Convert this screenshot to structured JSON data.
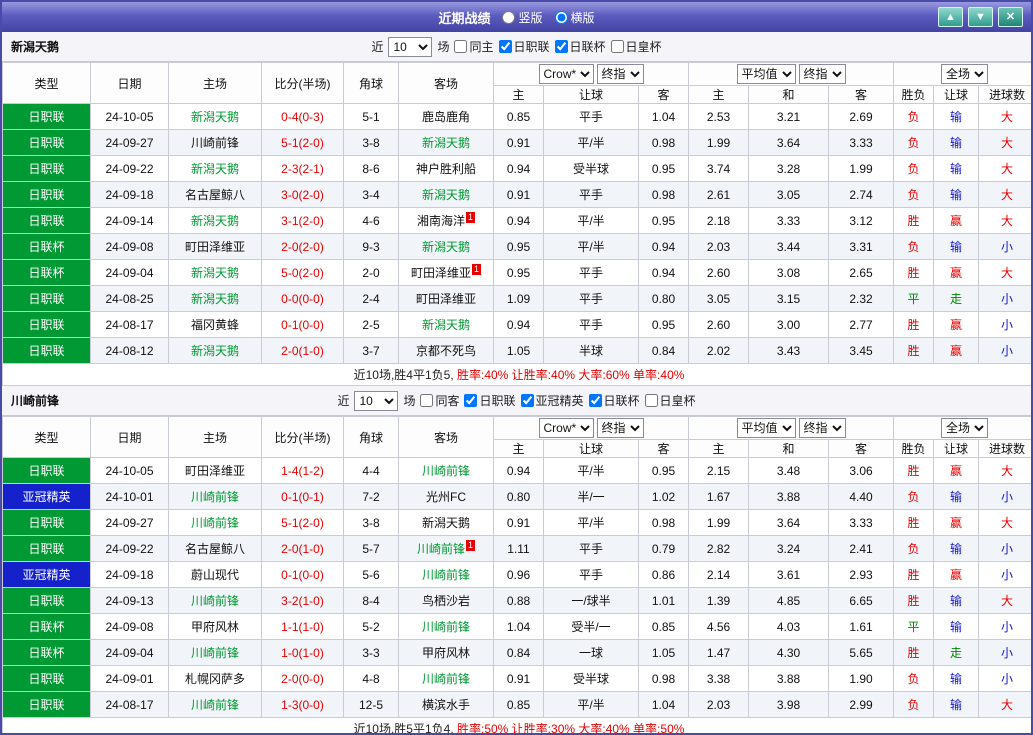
{
  "titlebar": {
    "title": "近期战绩",
    "layout_options": [
      {
        "label": "竖版",
        "selected": false
      },
      {
        "label": "横版",
        "selected": true
      }
    ],
    "up_icon": "▲",
    "down_icon": "▼",
    "close_icon": "✕"
  },
  "table_header": {
    "type": "类型",
    "date": "日期",
    "home": "主场",
    "score": "比分(半场)",
    "corner": "角球",
    "away": "客场",
    "bookmaker": "Crow*",
    "final_odds": "终指",
    "average": "平均值",
    "full_match": "全场",
    "asia_home": "主",
    "asia_handicap": "让球",
    "asia_away": "客",
    "euro_home": "主",
    "euro_draw": "和",
    "euro_away": "客",
    "result_wdl": "胜负",
    "result_handicap": "让球",
    "result_goals": "进球数"
  },
  "colors": {
    "league": {
      "日职联": "#009933",
      "日联杯": "#009933",
      "日皇杯": "#009933",
      "亚冠精英": "#1522cc"
    },
    "result": {
      "胜": "#e60000",
      "负": "#e60000",
      "平": "#008800",
      "赢": "#e60000",
      "输": "#1515cc",
      "走": "#008800",
      "大": "#e60000",
      "小": "#1515cc"
    },
    "team_highlight": "#009933",
    "score": "#e60000"
  },
  "sections": [
    {
      "team": "新潟天鹅",
      "controls": {
        "near": "近",
        "count": "10",
        "games": "场",
        "same_label": "同主",
        "same_checked": false,
        "competitions": [
          {
            "label": "日职联",
            "checked": true
          },
          {
            "label": "日联杯",
            "checked": true
          },
          {
            "label": "日皇杯",
            "checked": false
          }
        ]
      },
      "rows": [
        {
          "type": "日职联",
          "date": "24-10-05",
          "home": "新潟天鹅",
          "home_hl": true,
          "home_card": 0,
          "score": "0-4(0-3)",
          "corner": "5-1",
          "away": "鹿岛鹿角",
          "away_hl": false,
          "away_card": 0,
          "odds": [
            "0.85",
            "平手",
            "1.04",
            "2.53",
            "3.21",
            "2.69"
          ],
          "results": [
            "负",
            "输",
            "大"
          ]
        },
        {
          "type": "日职联",
          "date": "24-09-27",
          "home": "川崎前锋",
          "home_hl": false,
          "home_card": 0,
          "score": "5-1(2-0)",
          "corner": "3-8",
          "away": "新潟天鹅",
          "away_hl": true,
          "away_card": 0,
          "odds": [
            "0.91",
            "平/半",
            "0.98",
            "1.99",
            "3.64",
            "3.33"
          ],
          "results": [
            "负",
            "输",
            "大"
          ]
        },
        {
          "type": "日职联",
          "date": "24-09-22",
          "home": "新潟天鹅",
          "home_hl": true,
          "home_card": 0,
          "score": "2-3(2-1)",
          "corner": "8-6",
          "away": "神户胜利船",
          "away_hl": false,
          "away_card": 0,
          "odds": [
            "0.94",
            "受半球",
            "0.95",
            "3.74",
            "3.28",
            "1.99"
          ],
          "results": [
            "负",
            "输",
            "大"
          ]
        },
        {
          "type": "日职联",
          "date": "24-09-18",
          "home": "名古屋鲸八",
          "home_hl": false,
          "home_card": 0,
          "score": "3-0(2-0)",
          "corner": "3-4",
          "away": "新潟天鹅",
          "away_hl": true,
          "away_card": 0,
          "odds": [
            "0.91",
            "平手",
            "0.98",
            "2.61",
            "3.05",
            "2.74"
          ],
          "results": [
            "负",
            "输",
            "大"
          ]
        },
        {
          "type": "日职联",
          "date": "24-09-14",
          "home": "新潟天鹅",
          "home_hl": true,
          "home_card": 0,
          "score": "3-1(2-0)",
          "corner": "4-6",
          "away": "湘南海洋",
          "away_hl": false,
          "away_card": 1,
          "odds": [
            "0.94",
            "平/半",
            "0.95",
            "2.18",
            "3.33",
            "3.12"
          ],
          "results": [
            "胜",
            "赢",
            "大"
          ]
        },
        {
          "type": "日联杯",
          "date": "24-09-08",
          "home": "町田泽维亚",
          "home_hl": false,
          "home_card": 0,
          "score": "2-0(2-0)",
          "corner": "9-3",
          "away": "新潟天鹅",
          "away_hl": true,
          "away_card": 0,
          "odds": [
            "0.95",
            "平/半",
            "0.94",
            "2.03",
            "3.44",
            "3.31"
          ],
          "results": [
            "负",
            "输",
            "小"
          ]
        },
        {
          "type": "日联杯",
          "date": "24-09-04",
          "home": "新潟天鹅",
          "home_hl": true,
          "home_card": 0,
          "score": "5-0(2-0)",
          "corner": "2-0",
          "away": "町田泽维亚",
          "away_hl": false,
          "away_card": 1,
          "odds": [
            "0.95",
            "平手",
            "0.94",
            "2.60",
            "3.08",
            "2.65"
          ],
          "results": [
            "胜",
            "赢",
            "大"
          ]
        },
        {
          "type": "日职联",
          "date": "24-08-25",
          "home": "新潟天鹅",
          "home_hl": true,
          "home_card": 0,
          "score": "0-0(0-0)",
          "corner": "2-4",
          "away": "町田泽维亚",
          "away_hl": false,
          "away_card": 0,
          "odds": [
            "1.09",
            "平手",
            "0.80",
            "3.05",
            "3.15",
            "2.32"
          ],
          "results": [
            "平",
            "走",
            "小"
          ]
        },
        {
          "type": "日职联",
          "date": "24-08-17",
          "home": "福冈黄蜂",
          "home_hl": false,
          "home_card": 0,
          "score": "0-1(0-0)",
          "corner": "2-5",
          "away": "新潟天鹅",
          "away_hl": true,
          "away_card": 0,
          "odds": [
            "0.94",
            "平手",
            "0.95",
            "2.60",
            "3.00",
            "2.77"
          ],
          "results": [
            "胜",
            "赢",
            "小"
          ]
        },
        {
          "type": "日职联",
          "date": "24-08-12",
          "home": "新潟天鹅",
          "home_hl": true,
          "home_card": 0,
          "score": "2-0(1-0)",
          "corner": "3-7",
          "away": "京都不死鸟",
          "away_hl": false,
          "away_card": 0,
          "odds": [
            "1.05",
            "半球",
            "0.84",
            "2.02",
            "3.43",
            "3.45"
          ],
          "results": [
            "胜",
            "赢",
            "小"
          ]
        }
      ],
      "summary": {
        "record": "近10场,胜4平1负5, ",
        "rates": "胜率:40%  让胜率:40%  大率:60%  单率:40%"
      }
    },
    {
      "team": "川崎前锋",
      "controls": {
        "near": "近",
        "count": "10",
        "games": "场",
        "same_label": "同客",
        "same_checked": false,
        "competitions": [
          {
            "label": "日职联",
            "checked": true
          },
          {
            "label": "亚冠精英",
            "checked": true
          },
          {
            "label": "日联杯",
            "checked": true
          },
          {
            "label": "日皇杯",
            "checked": false
          }
        ]
      },
      "rows": [
        {
          "type": "日职联",
          "date": "24-10-05",
          "home": "町田泽维亚",
          "home_hl": false,
          "home_card": 0,
          "score": "1-4(1-2)",
          "corner": "4-4",
          "away": "川崎前锋",
          "away_hl": true,
          "away_card": 0,
          "odds": [
            "0.94",
            "平/半",
            "0.95",
            "2.15",
            "3.48",
            "3.06"
          ],
          "results": [
            "胜",
            "赢",
            "大"
          ]
        },
        {
          "type": "亚冠精英",
          "date": "24-10-01",
          "home": "川崎前锋",
          "home_hl": true,
          "home_card": 0,
          "score": "0-1(0-1)",
          "corner": "7-2",
          "away": "光州FC",
          "away_hl": false,
          "away_card": 0,
          "odds": [
            "0.80",
            "半/一",
            "1.02",
            "1.67",
            "3.88",
            "4.40"
          ],
          "results": [
            "负",
            "输",
            "小"
          ]
        },
        {
          "type": "日职联",
          "date": "24-09-27",
          "home": "川崎前锋",
          "home_hl": true,
          "home_card": 0,
          "score": "5-1(2-0)",
          "corner": "3-8",
          "away": "新潟天鹅",
          "away_hl": false,
          "away_card": 0,
          "odds": [
            "0.91",
            "平/半",
            "0.98",
            "1.99",
            "3.64",
            "3.33"
          ],
          "results": [
            "胜",
            "赢",
            "大"
          ]
        },
        {
          "type": "日职联",
          "date": "24-09-22",
          "home": "名古屋鲸八",
          "home_hl": false,
          "home_card": 0,
          "score": "2-0(1-0)",
          "corner": "5-7",
          "away": "川崎前锋",
          "away_hl": true,
          "away_card": 1,
          "odds": [
            "1.11",
            "平手",
            "0.79",
            "2.82",
            "3.24",
            "2.41"
          ],
          "results": [
            "负",
            "输",
            "小"
          ]
        },
        {
          "type": "亚冠精英",
          "date": "24-09-18",
          "home": "蔚山现代",
          "home_hl": false,
          "home_card": 0,
          "score": "0-1(0-0)",
          "corner": "5-6",
          "away": "川崎前锋",
          "away_hl": true,
          "away_card": 0,
          "odds": [
            "0.96",
            "平手",
            "0.86",
            "2.14",
            "3.61",
            "2.93"
          ],
          "results": [
            "胜",
            "赢",
            "小"
          ]
        },
        {
          "type": "日职联",
          "date": "24-09-13",
          "home": "川崎前锋",
          "home_hl": true,
          "home_card": 0,
          "score": "3-2(1-0)",
          "corner": "8-4",
          "away": "鸟栖沙岩",
          "away_hl": false,
          "away_card": 0,
          "odds": [
            "0.88",
            "一/球半",
            "1.01",
            "1.39",
            "4.85",
            "6.65"
          ],
          "results": [
            "胜",
            "输",
            "大"
          ]
        },
        {
          "type": "日联杯",
          "date": "24-09-08",
          "home": "甲府风林",
          "home_hl": false,
          "home_card": 0,
          "score": "1-1(1-0)",
          "corner": "5-2",
          "away": "川崎前锋",
          "away_hl": true,
          "away_card": 0,
          "odds": [
            "1.04",
            "受半/一",
            "0.85",
            "4.56",
            "4.03",
            "1.61"
          ],
          "results": [
            "平",
            "输",
            "小"
          ]
        },
        {
          "type": "日联杯",
          "date": "24-09-04",
          "home": "川崎前锋",
          "home_hl": true,
          "home_card": 0,
          "score": "1-0(1-0)",
          "corner": "3-3",
          "away": "甲府风林",
          "away_hl": false,
          "away_card": 0,
          "odds": [
            "0.84",
            "一球",
            "1.05",
            "1.47",
            "4.30",
            "5.65"
          ],
          "results": [
            "胜",
            "走",
            "小"
          ]
        },
        {
          "type": "日职联",
          "date": "24-09-01",
          "home": "札幌冈萨多",
          "home_hl": false,
          "home_card": 0,
          "score": "2-0(0-0)",
          "corner": "4-8",
          "away": "川崎前锋",
          "away_hl": true,
          "away_card": 0,
          "odds": [
            "0.91",
            "受半球",
            "0.98",
            "3.38",
            "3.88",
            "1.90"
          ],
          "results": [
            "负",
            "输",
            "小"
          ]
        },
        {
          "type": "日职联",
          "date": "24-08-17",
          "home": "川崎前锋",
          "home_hl": true,
          "home_card": 0,
          "score": "1-3(0-0)",
          "corner": "12-5",
          "away": "横滨水手",
          "away_hl": false,
          "away_card": 0,
          "odds": [
            "0.85",
            "平/半",
            "1.04",
            "2.03",
            "3.98",
            "2.99"
          ],
          "results": [
            "负",
            "输",
            "大"
          ]
        }
      ],
      "summary": {
        "record": "近10场,胜5平1负4, ",
        "rates": "胜率:50%  让胜率:30%  大率:40%  单率:50%"
      }
    }
  ]
}
